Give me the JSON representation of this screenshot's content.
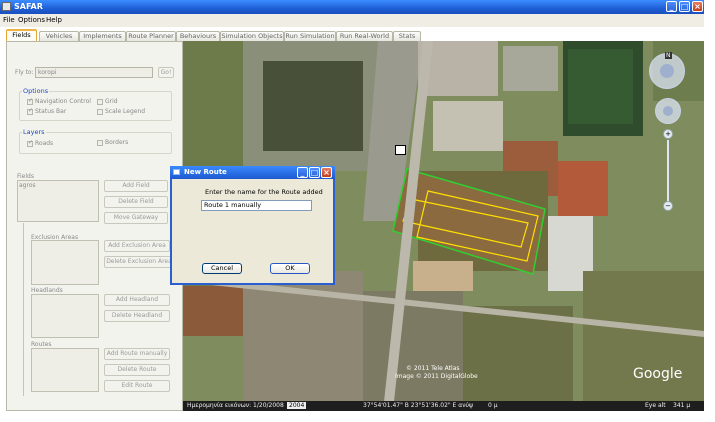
{
  "window": {
    "title": "SAFAR"
  },
  "menu": [
    "File",
    "Options",
    "Help"
  ],
  "tabs": [
    "Fields",
    "Vehicles",
    "Implements",
    "Route Planner",
    "Behaviours",
    "Simulation Objects",
    "Run Simulation",
    "Run Real-World",
    "Stats"
  ],
  "left": {
    "fly_to_label": "Fly to:",
    "fly_to_value": "koropi",
    "go_label": "Go!",
    "options_header": "Options",
    "options": [
      {
        "label": "Navigation Control",
        "checked": true
      },
      {
        "label": "Grid",
        "checked": false
      },
      {
        "label": "Status Bar",
        "checked": true
      },
      {
        "label": "Scale Legend",
        "checked": false
      }
    ],
    "layers_header": "Layers",
    "layers": [
      {
        "label": "Roads",
        "checked": true
      },
      {
        "label": "Borders",
        "checked": false
      }
    ],
    "fields_label": "Fields",
    "fields_item": "agros",
    "add_field": "Add Field",
    "delete_field": "Delete Field",
    "move_gateway": "Move Gateway",
    "exclusion_label": "Exclusion Areas",
    "add_exclusion": "Add Exclusion Area",
    "delete_exclusion": "Delete Exclusion Area",
    "headlands_label": "Headlands",
    "add_headland": "Add Headland",
    "delete_headland": "Delete Headland",
    "routes_label": "Routes",
    "add_route": "Add Route manually",
    "delete_route": "Delete Route",
    "edit_route": "Edit Route"
  },
  "dialog": {
    "title": "New Route",
    "prompt": "Enter the name for the Route added",
    "value": "Route 1 manually",
    "cancel": "Cancel",
    "ok": "OK"
  },
  "map": {
    "copyright1": "© 2011 Tele Atlas",
    "copyright2": "Image © 2011 DigitalGlobe",
    "google": "Google",
    "compass_n": "N",
    "status_date": "Ημερομηνία εικόνων: 1/20/2008",
    "status_coords": "37°54'01.47\" B   23°51'36.02\" E   ανύψ",
    "status_alt": "0 μ",
    "status_eye": "Eye alt",
    "status_eye_val": "341 μ",
    "year_badge": "2004"
  },
  "colors": {
    "field_outline": "#2fcf32",
    "route_outline": "#ffe000",
    "titlebar": "#1f5fd6"
  }
}
